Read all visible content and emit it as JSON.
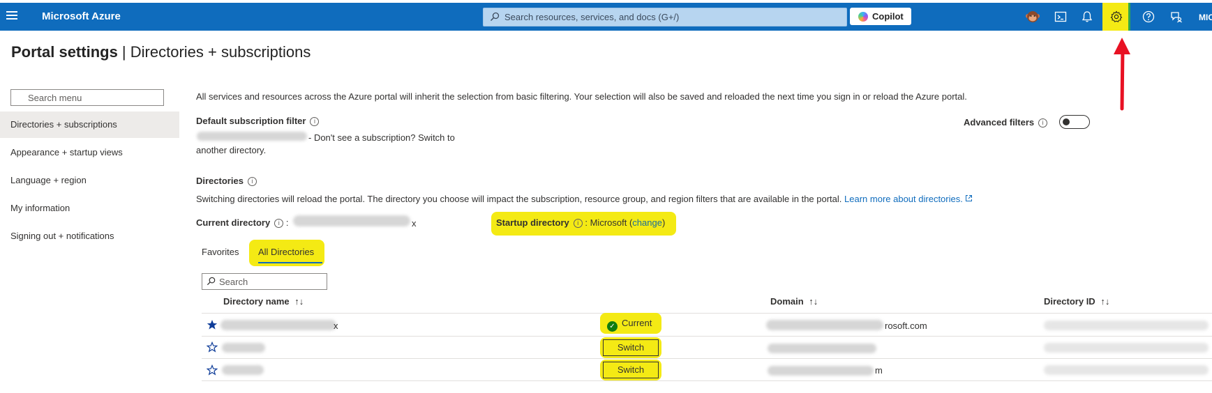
{
  "topbar": {
    "brand": "Microsoft Azure",
    "search_placeholder": "Search resources, services, and docs (G+/)",
    "copilot_label": "Copilot",
    "user_initials_partial": "MIC"
  },
  "page": {
    "title_bold": "Portal settings",
    "title_separator": " | ",
    "title_section": "Directories + subscriptions"
  },
  "sidebar": {
    "search_placeholder": "Search menu",
    "items": [
      {
        "label": "Directories + subscriptions"
      },
      {
        "label": "Appearance + startup views"
      },
      {
        "label": "Language + region"
      },
      {
        "label": "My information"
      },
      {
        "label": "Signing out + notifications"
      }
    ]
  },
  "main": {
    "intro": "All services and resources across the Azure portal will inherit the selection from basic filtering. Your selection will also be saved and reloaded the next time you sign in or reload the Azure portal.",
    "default_filter_label": "Default subscription filter",
    "default_filter_text_1": "- Don't see a subscription? Switch to",
    "default_filter_text_2": "another directory.",
    "advanced_filters_label": "Advanced filters",
    "directories_heading": "Directories",
    "directories_desc": "Switching directories will reload the portal. The directory you choose will impact the subscription, resource group, and region filters that are available in the portal.",
    "learn_more": "Learn more about directories.",
    "current_directory_label": "Current directory",
    "current_directory_colon": ":",
    "current_directory_tail": "x",
    "startup_directory_label": "Startup directory",
    "startup_directory_value": ": Microsoft (",
    "startup_change": "change",
    "startup_close": ")"
  },
  "tabs": [
    {
      "label": "Favorites"
    },
    {
      "label": "All Directories"
    }
  ],
  "grid": {
    "search_placeholder": "Search",
    "columns": {
      "name": "Directory name",
      "domain": "Domain",
      "id": "Directory ID"
    },
    "sort_glyph": "↑↓",
    "rows": [
      {
        "status": "Current",
        "domain_tail": "rosoft.com",
        "name_tail": "x"
      },
      {
        "status": "Switch",
        "domain_tail": ""
      },
      {
        "status": "Switch",
        "domain_tail": "m"
      }
    ]
  },
  "colors": {
    "azure_blue": "#0f6cbd",
    "highlight_yellow": "#f4ea14",
    "annotation_red": "#e81123"
  }
}
